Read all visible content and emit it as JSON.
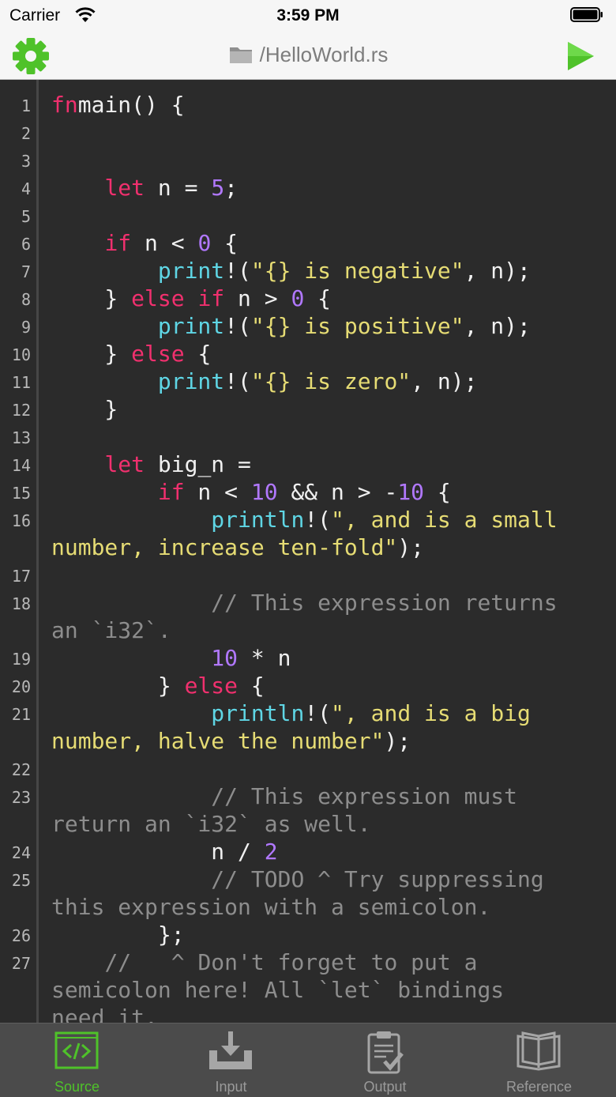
{
  "status_bar": {
    "carrier": "Carrier",
    "time": "3:59 PM"
  },
  "nav": {
    "title": "/HelloWorld.rs",
    "settings_icon": "gear-icon",
    "run_icon": "play-icon"
  },
  "colors": {
    "accent": "#4fc22a",
    "keyword": "#f0306e",
    "number": "#b178ff",
    "function": "#5fd6e5",
    "string": "#e6dc74",
    "comment": "#8d8d8d"
  },
  "editor": {
    "lines": [
      {
        "n": "1",
        "segs": [
          [
            "kw",
            "fn"
          ],
          [
            "",
            "main() {"
          ]
        ]
      },
      {
        "n": "2",
        "segs": []
      },
      {
        "n": "3",
        "segs": []
      },
      {
        "n": "4",
        "segs": [
          [
            "",
            "    "
          ],
          [
            "kw",
            "let"
          ],
          [
            "",
            " n = "
          ],
          [
            "num",
            "5"
          ],
          [
            "",
            ";"
          ]
        ]
      },
      {
        "n": "5",
        "segs": []
      },
      {
        "n": "6",
        "segs": [
          [
            "",
            "    "
          ],
          [
            "kw",
            "if"
          ],
          [
            "",
            " n < "
          ],
          [
            "num",
            "0"
          ],
          [
            "",
            " {"
          ]
        ]
      },
      {
        "n": "7",
        "segs": [
          [
            "",
            "        "
          ],
          [
            "fn",
            "print"
          ],
          [
            "",
            "!("
          ],
          [
            "str",
            "\"{} is negative\""
          ],
          [
            "",
            ", n);"
          ]
        ]
      },
      {
        "n": "8",
        "segs": [
          [
            "",
            "    } "
          ],
          [
            "kw",
            "else if"
          ],
          [
            "",
            " n > "
          ],
          [
            "num",
            "0"
          ],
          [
            "",
            " {"
          ]
        ]
      },
      {
        "n": "9",
        "segs": [
          [
            "",
            "        "
          ],
          [
            "fn",
            "print"
          ],
          [
            "",
            "!("
          ],
          [
            "str",
            "\"{} is positive\""
          ],
          [
            "",
            ", n);"
          ]
        ]
      },
      {
        "n": "10",
        "segs": [
          [
            "",
            "    } "
          ],
          [
            "kw",
            "else"
          ],
          [
            "",
            " {"
          ]
        ]
      },
      {
        "n": "11",
        "segs": [
          [
            "",
            "        "
          ],
          [
            "fn",
            "print"
          ],
          [
            "",
            "!("
          ],
          [
            "str",
            "\"{} is zero\""
          ],
          [
            "",
            ", n);"
          ]
        ]
      },
      {
        "n": "12",
        "segs": [
          [
            "",
            "    }"
          ]
        ]
      },
      {
        "n": "13",
        "segs": []
      },
      {
        "n": "14",
        "segs": [
          [
            "",
            "    "
          ],
          [
            "kw",
            "let"
          ],
          [
            "",
            " big_n ="
          ]
        ]
      },
      {
        "n": "15",
        "segs": [
          [
            "",
            "        "
          ],
          [
            "kw",
            "if"
          ],
          [
            "",
            " n < "
          ],
          [
            "num",
            "10"
          ],
          [
            "",
            " && n > -"
          ],
          [
            "num",
            "10"
          ],
          [
            "",
            " {"
          ]
        ]
      },
      {
        "n": "16",
        "segs": [
          [
            "",
            "            "
          ],
          [
            "fn",
            "println"
          ],
          [
            "",
            "!("
          ],
          [
            "str",
            "\", and is a small\nnumber, increase ten-fold\""
          ],
          [
            "",
            ");"
          ]
        ]
      },
      {
        "n": "17",
        "segs": []
      },
      {
        "n": "18",
        "segs": [
          [
            "",
            "            "
          ],
          [
            "cmt",
            "// This expression returns\nan `i32`."
          ]
        ]
      },
      {
        "n": "19",
        "segs": [
          [
            "",
            "            "
          ],
          [
            "num",
            "10"
          ],
          [
            "",
            " * n"
          ]
        ]
      },
      {
        "n": "20",
        "segs": [
          [
            "",
            "        } "
          ],
          [
            "kw",
            "else"
          ],
          [
            "",
            " {"
          ]
        ]
      },
      {
        "n": "21",
        "segs": [
          [
            "",
            "            "
          ],
          [
            "fn",
            "println"
          ],
          [
            "",
            "!("
          ],
          [
            "str",
            "\", and is a big\nnumber, halve the number\""
          ],
          [
            "",
            ");"
          ]
        ]
      },
      {
        "n": "22",
        "segs": []
      },
      {
        "n": "23",
        "segs": [
          [
            "",
            "            "
          ],
          [
            "cmt",
            "// This expression must\nreturn an `i32` as well."
          ]
        ]
      },
      {
        "n": "24",
        "segs": [
          [
            "",
            "            n / "
          ],
          [
            "num",
            "2"
          ]
        ]
      },
      {
        "n": "25",
        "segs": [
          [
            "",
            "            "
          ],
          [
            "cmt",
            "// TODO ^ Try suppressing\nthis expression with a semicolon."
          ]
        ]
      },
      {
        "n": "26",
        "segs": [
          [
            "",
            "        };"
          ]
        ]
      },
      {
        "n": "27",
        "segs": [
          [
            "",
            "    "
          ],
          [
            "cmt",
            "//   ^ Don't forget to put a\nsemicolon here! All `let` bindings\nneed it."
          ]
        ]
      }
    ]
  },
  "tabs": [
    {
      "label": "Source",
      "icon": "source-code-icon",
      "active": true
    },
    {
      "label": "Input",
      "icon": "input-tray-icon",
      "active": false
    },
    {
      "label": "Output",
      "icon": "clipboard-check-icon",
      "active": false
    },
    {
      "label": "Reference",
      "icon": "book-icon",
      "active": false
    }
  ]
}
